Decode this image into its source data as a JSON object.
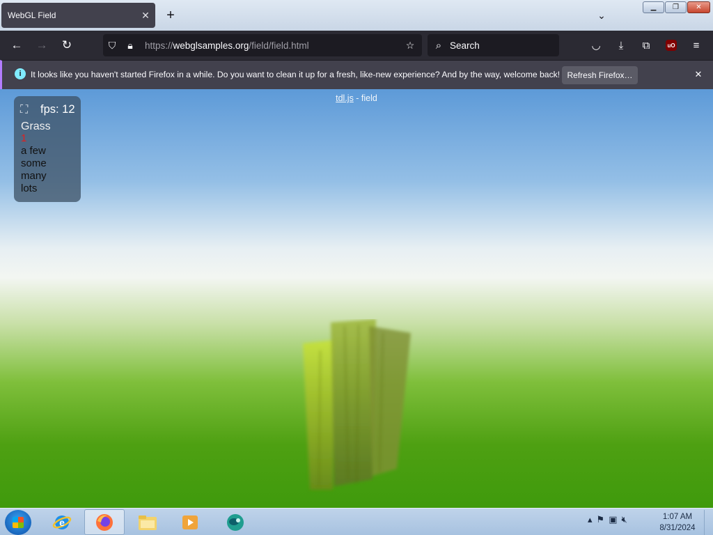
{
  "browser": {
    "tab_title": "WebGL Field",
    "url_prefix": "https://",
    "url_domain": "webglsamples.org",
    "url_path": "/field/field.html",
    "search_placeholder": "Search"
  },
  "notification": {
    "message": "It looks like you haven't started Firefox in a while. Do you want to clean it up for a fresh, like-new experience? And by the way, welcome back!",
    "refresh_label": "Refresh Firefox…"
  },
  "page": {
    "credit_link": "tdl.js",
    "credit_suffix": " - field",
    "fps_label": "fps: 12",
    "setting_label": "Grass",
    "setting_value": "1",
    "options": [
      "a few",
      "some",
      "many",
      "lots"
    ]
  },
  "taskbar": {
    "time": "1:07 AM",
    "date": "8/31/2024"
  },
  "colors": {
    "accent": "#b37dff",
    "value_red": "#e0201f"
  }
}
